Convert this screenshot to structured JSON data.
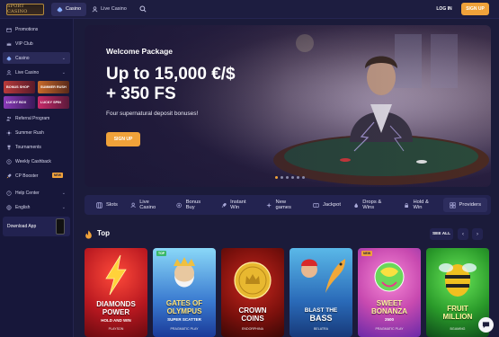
{
  "header": {
    "logo_text": "SPORT CASINO",
    "tabs": [
      {
        "label": "Casino",
        "active": true
      },
      {
        "label": "Live Casino",
        "active": false
      }
    ],
    "login_label": "LOG IN",
    "signup_label": "SIGN UP"
  },
  "sidebar": {
    "items_top": [
      {
        "label": "Promotions",
        "icon": "gift-icon"
      },
      {
        "label": "VIP Club",
        "icon": "crown-icon"
      },
      {
        "label": "Casino",
        "icon": "spade-icon",
        "selected": true
      },
      {
        "label": "Live Casino",
        "icon": "dealer-icon"
      }
    ],
    "promos": [
      {
        "label": "BONUS SHOP",
        "color": "#b83a3a"
      },
      {
        "label": "SUMMER RUSH",
        "color": "#c86a2a"
      },
      {
        "label": "LUCKY BOX",
        "color": "#8a3ab8"
      },
      {
        "label": "LUCKY SPIN",
        "color": "#c82a6a"
      }
    ],
    "items_bottom": [
      {
        "label": "Referral Program",
        "icon": "people-icon"
      },
      {
        "label": "Summer Rush",
        "icon": "sun-icon"
      },
      {
        "label": "Tournaments",
        "icon": "trophy-icon"
      },
      {
        "label": "Weekly Cashback",
        "icon": "cashback-icon"
      },
      {
        "label": "CP Booster",
        "icon": "rocket-icon",
        "badge": "NEW"
      }
    ],
    "help_label": "Help Center",
    "language_label": "English",
    "download_label": "Download App"
  },
  "hero": {
    "title": "Welcome Package",
    "headline_1": "Up to 15,000 €/$",
    "headline_2": "+ 350 FS",
    "subtitle": "Four supernatural deposit bonuses!",
    "cta": "SIGN UP",
    "slide_count": 6,
    "active_slide": 1
  },
  "categories": [
    {
      "label": "Slots",
      "icon": "slot-icon"
    },
    {
      "label": "Live Casino",
      "icon": "dealer-icon"
    },
    {
      "label": "Bonus Buy",
      "icon": "coin-icon"
    },
    {
      "label": "Instant Win",
      "icon": "rocket-icon"
    },
    {
      "label": "New games",
      "icon": "sparkle-icon"
    },
    {
      "label": "Jackpot",
      "icon": "jackpot-icon"
    },
    {
      "label": "Drops & Wins",
      "icon": "drops-icon"
    },
    {
      "label": "Hold & Win",
      "icon": "hold-icon"
    },
    {
      "label": "Providers",
      "icon": "grid-icon"
    }
  ],
  "top_section": {
    "title": "Top",
    "see_all": "SEE ALL",
    "prev": "‹",
    "next": "›"
  },
  "games": [
    {
      "line1": "DIAMONDS",
      "line2": "POWER",
      "sub": "HOLD AND WIN",
      "provider": "PLAYSON",
      "bg1": "#d8242a",
      "bg2": "#7a0d12",
      "tag": ""
    },
    {
      "line1": "GATES OF",
      "line2": "OLYMPUS",
      "sub": "SUPER SCATTER",
      "provider": "PRAGMATIC PLAY",
      "bg1": "#6ac8ee",
      "bg2": "#2a5ab8",
      "tag": "TOP"
    },
    {
      "line1": "CROWN",
      "line2": "COINS",
      "sub": "",
      "provider": "ENDORPHINA",
      "bg1": "#b8201a",
      "bg2": "#4a0a08",
      "tag": ""
    },
    {
      "line1": "BLAST THE",
      "line2": "BASS",
      "sub": "",
      "provider": "BELATRA",
      "bg1": "#3a9ad8",
      "bg2": "#1a3a78",
      "tag": ""
    },
    {
      "line1": "SWEET",
      "line2": "BONANZA",
      "sub": "2500",
      "provider": "PRAGMATIC PLAY",
      "bg1": "#e85ac8",
      "bg2": "#7a2ab8",
      "tag": "NEW"
    },
    {
      "line1": "FRUIT",
      "line2": "MILLION",
      "sub": "",
      "provider": "BGAMING",
      "bg1": "#3ab83a",
      "bg2": "#0e5a1a",
      "tag": ""
    }
  ],
  "colors": {
    "accent": "#f0a23a",
    "background": "#1b1b3a",
    "sidebar": "#17173a",
    "panel": "#232350"
  }
}
